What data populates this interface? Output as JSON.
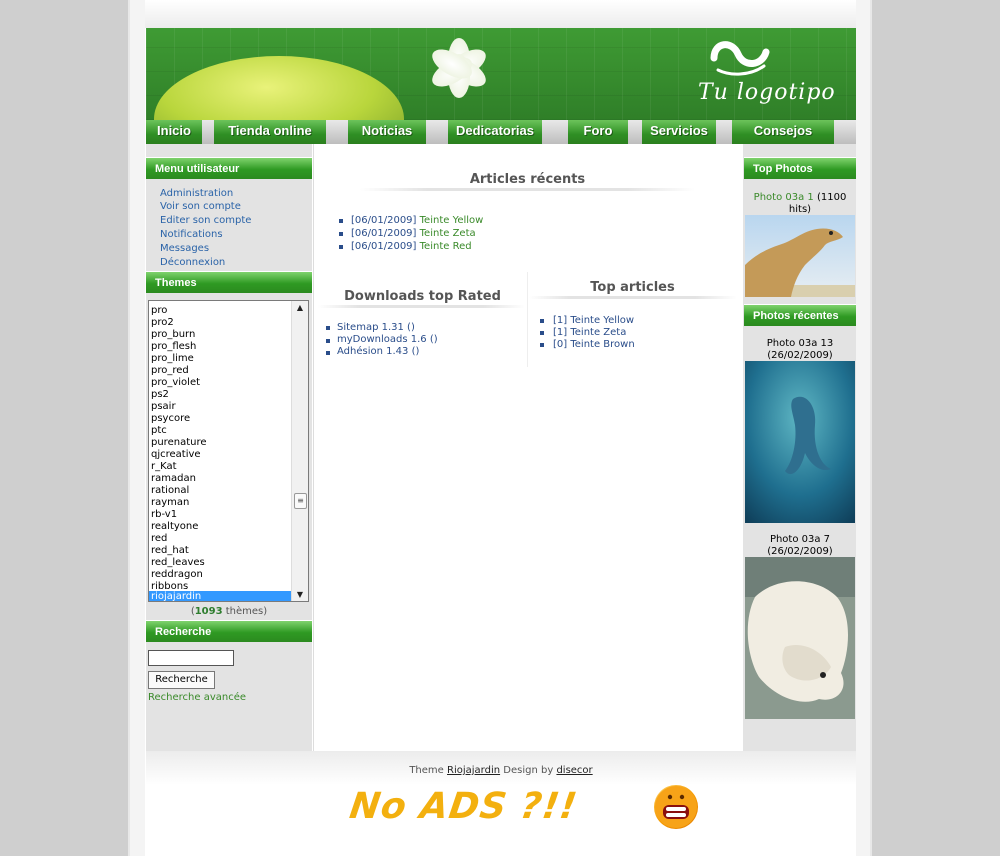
{
  "nav": [
    "Inicio",
    "Tienda online",
    "Noticias",
    "Dedicatorias",
    "Foro",
    "Servicios",
    "Consejos"
  ],
  "logo_text": "Tu logotipo",
  "user_menu": {
    "title": "Menu utilisateur",
    "items": [
      "Administration",
      "Voir son compte",
      "Editer son compte",
      "Notifications",
      "Messages",
      "Déconnexion"
    ]
  },
  "themes": {
    "title": "Themes",
    "items": [
      "pro",
      "pro2",
      "pro_burn",
      "pro_flesh",
      "pro_lime",
      "pro_red",
      "pro_violet",
      "ps2",
      "psair",
      "psycore",
      "ptc",
      "purenature",
      "qjcreative",
      "r_Kat",
      "ramadan",
      "rational",
      "rayman",
      "rb-v1",
      "realtyone",
      "red",
      "red_hat",
      "red_leaves",
      "reddragon",
      "ribbons",
      "riojajardin"
    ],
    "selected": "riojajardin",
    "count_open": "(",
    "count_value": "1093",
    "count_suffix": "thèmes)"
  },
  "search": {
    "title": "Recherche",
    "button": "Recherche",
    "advanced": "Recherche avancée",
    "value": ""
  },
  "recent_articles": {
    "title": "Articles récents",
    "items": [
      {
        "date": "[06/01/2009]",
        "title": "Teinte Yellow"
      },
      {
        "date": "[06/01/2009]",
        "title": "Teinte Zeta"
      },
      {
        "date": "[06/01/2009]",
        "title": "Teinte Red"
      }
    ]
  },
  "downloads": {
    "title": "Downloads top Rated",
    "items": [
      "Sitemap 1.31 ()",
      "myDownloads 1.6 ()",
      "Adhésion 1.43 ()"
    ]
  },
  "top_articles": {
    "title": "Top articles",
    "items": [
      {
        "count": "[1]",
        "title": "Teinte Yellow"
      },
      {
        "count": "[1]",
        "title": "Teinte Zeta"
      },
      {
        "count": "[0]",
        "title": "Brown"
      }
    ]
  },
  "top_photos": {
    "title": "Top Photos",
    "caption_link": "Photo 03a 1",
    "caption_hits": "(1100 hits)"
  },
  "recent_photos": {
    "title": "Photos récentes",
    "items": [
      {
        "name": "Photo 03a 13",
        "date": "(26/02/2009)"
      },
      {
        "name": "Photo 03a 7",
        "date": "(26/02/2009)"
      }
    ]
  },
  "footer": {
    "theme_label": "Theme",
    "theme_name": "Riojajardin",
    "design_by": "Design by",
    "designer": "disecor",
    "noads": "No ADS ?!!"
  },
  "colors": {
    "accent_green": "#2f9a23",
    "link_blue": "#2a4d8a",
    "link_green": "#3a8a2a",
    "selected": "#3399ff"
  }
}
